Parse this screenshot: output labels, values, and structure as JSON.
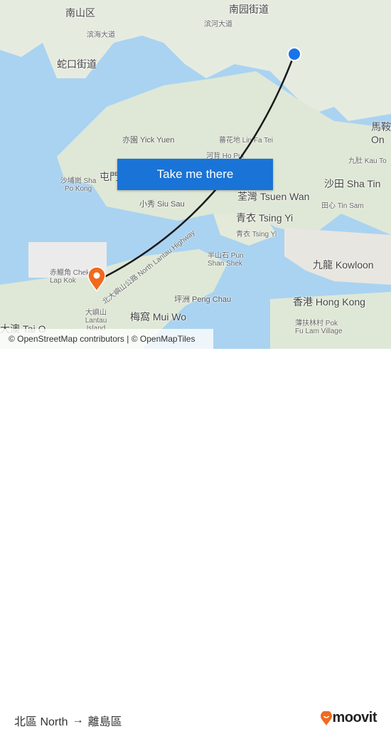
{
  "map": {
    "labels": [
      {
        "text": "南山区",
        "cls": "big"
      },
      {
        "text": "南园街道",
        "cls": "big"
      },
      {
        "text": "滨海大道",
        "cls": "sm"
      },
      {
        "text": "滨河大道",
        "cls": "sm"
      },
      {
        "text": "蛇口街道",
        "cls": "big"
      },
      {
        "text": "亦園 Yick Yuen",
        "cls": ""
      },
      {
        "text": "蕃花地 Lin Fa Tei",
        "cls": "sm"
      },
      {
        "text": "河背 Ho Pui",
        "cls": "sm"
      },
      {
        "text": "沙埔崗 Sha Po Kong",
        "cls": "sm"
      },
      {
        "text": "屯門",
        "cls": "big"
      },
      {
        "text": "荃灣 Tsuen Wan",
        "cls": "big"
      },
      {
        "text": "沙田 Sha Tin",
        "cls": "big"
      },
      {
        "text": "九肚 Kau To",
        "cls": "sm"
      },
      {
        "text": "馬鞍 On",
        "cls": "big"
      },
      {
        "text": "田心 Tin Sam",
        "cls": "sm"
      },
      {
        "text": "小秀 Siu Sau",
        "cls": ""
      },
      {
        "text": "青衣 Tsing Yi",
        "cls": "big"
      },
      {
        "text": "青衣 Tsing Yi",
        "cls": "sm"
      },
      {
        "text": "半山石 Pun Shan Shek",
        "cls": "sm"
      },
      {
        "text": "九龍 Kowloon",
        "cls": "big"
      },
      {
        "text": "赤鱲角 Chek Lap Kok",
        "cls": "sm"
      },
      {
        "text": "北大嶼山公路 North Lantau Highway",
        "cls": "sm"
      },
      {
        "text": "大嶼山 Lantau Island",
        "cls": "sm"
      },
      {
        "text": "坪洲 Peng Chau",
        "cls": ""
      },
      {
        "text": "梅窩 Mui Wo",
        "cls": "big"
      },
      {
        "text": "香港 Hong Kong",
        "cls": "big"
      },
      {
        "text": "薄扶林村 Pok Fu Lam Village",
        "cls": "sm"
      },
      {
        "text": "大澳 Tai O",
        "cls": "big"
      }
    ],
    "attribution": "© OpenStreetMap contributors | © OpenMapTiles",
    "cta_label": "Take me there",
    "colors": {
      "water": "#aad3f1",
      "land": "#e9efe3",
      "route": "#1a1a1a",
      "origin": "#1a73e8",
      "destination": "#f06a1e",
      "button": "#1a73d6"
    }
  },
  "footer": {
    "origin": "北區 North",
    "arrow": "→",
    "destination": "離島區",
    "brand": "moovit"
  }
}
